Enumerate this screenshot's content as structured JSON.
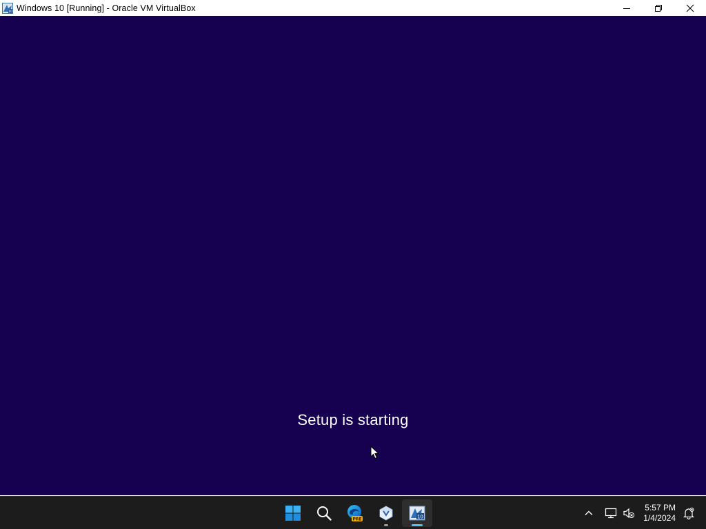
{
  "window": {
    "title": "Windows 10 [Running] - Oracle VM VirtualBox",
    "icon": "virtualbox-app-icon"
  },
  "window_controls": {
    "minimize_icon": "minimize-icon",
    "restore_icon": "restore-icon",
    "close_icon": "close-icon"
  },
  "vm_screen": {
    "background_color": "#160050",
    "status_text": "Setup is starting"
  },
  "taskbar": {
    "pinned": [
      {
        "name": "Start",
        "icon": "windows-start-icon"
      },
      {
        "name": "Search",
        "icon": "search-icon"
      },
      {
        "name": "Microsoft Edge Preview",
        "icon": "edge-preview-icon",
        "badge": "PRE"
      },
      {
        "name": "Oracle VM VirtualBox",
        "icon": "virtualbox-icon",
        "running": true
      },
      {
        "name": "Windows 10 [Running] - Oracle VM VirtualBox",
        "icon": "virtualbox-vm-icon",
        "active": true
      }
    ],
    "tray": {
      "chevron_icon": "chevron-up-icon",
      "network_icon": "network-icon",
      "volume_icon": "volume-muted-icon",
      "notification_icon": "notification-bell-icon"
    },
    "clock": {
      "time": "5:57 PM",
      "date": "1/4/2024"
    },
    "accent_color": "#4cc2ff"
  }
}
